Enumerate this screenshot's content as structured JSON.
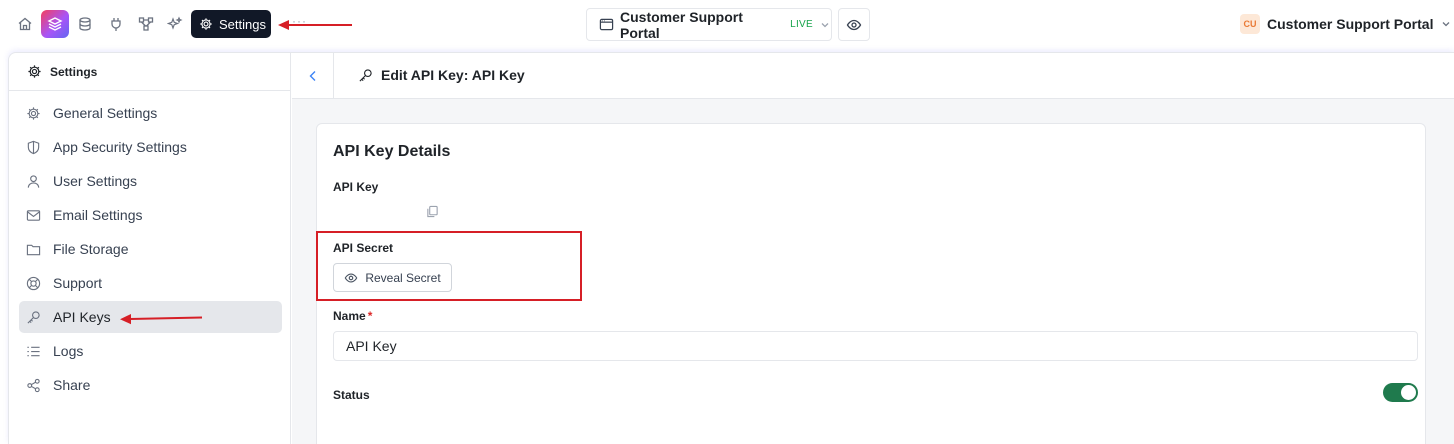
{
  "topbar": {
    "settings_label": "Settings",
    "more": "···",
    "app_name": "Customer Support Portal",
    "app_status": "LIVE",
    "org_initials": "CU",
    "org_name": "Customer Support Portal"
  },
  "sidebar": {
    "title": "Settings",
    "items": [
      {
        "label": "General Settings",
        "icon": "gear-icon"
      },
      {
        "label": "App Security Settings",
        "icon": "shield-icon"
      },
      {
        "label": "User Settings",
        "icon": "user-icon"
      },
      {
        "label": "Email Settings",
        "icon": "mail-icon"
      },
      {
        "label": "File Storage",
        "icon": "folder-icon"
      },
      {
        "label": "Support",
        "icon": "lifebuoy-icon"
      },
      {
        "label": "API Keys",
        "icon": "key-icon",
        "active": true
      },
      {
        "label": "Logs",
        "icon": "list-icon"
      },
      {
        "label": "Share",
        "icon": "share-icon"
      }
    ]
  },
  "main": {
    "title": "Edit API Key: API Key",
    "card_title": "API Key Details",
    "api_key_label": "API Key",
    "api_secret_label": "API Secret",
    "reveal_label": "Reveal Secret",
    "name_label": "Name",
    "name_required": "*",
    "name_value": "API Key",
    "status_label": "Status",
    "status_on": true
  },
  "colors": {
    "accent": "#3b82f6",
    "toggle_on": "#1f7a4d",
    "annotation": "#d61f26",
    "live": "#16a34a"
  }
}
